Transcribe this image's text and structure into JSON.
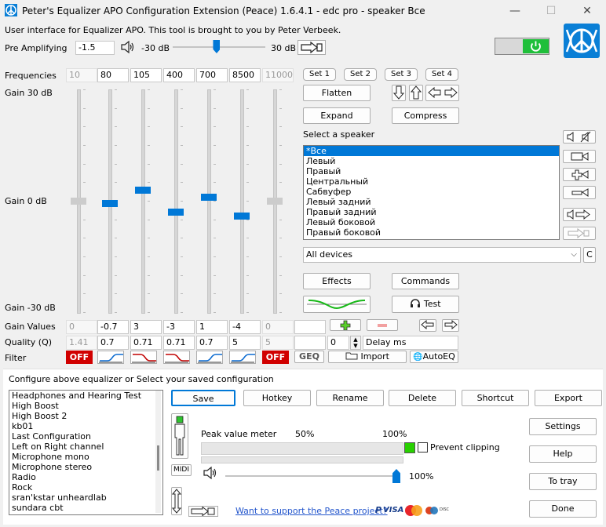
{
  "window": {
    "title": "Peter's Equalizer APO Configuration Extension (Peace) 1.6.4.1 - edc pro - speaker Все",
    "minimize": "—",
    "maximize": "☐",
    "close": "✕"
  },
  "intro": "User interface for Equalizer APO. This tool is brought to you by Peter Verbeek.",
  "preamp": {
    "label": "Pre Amplifying",
    "value": "-1.5",
    "min_label": "-30 dB",
    "max_label": "30 dB",
    "level_fraction": 0.47
  },
  "power_on": true,
  "eq": {
    "frequencies_label": "Frequencies",
    "gain_top_label": "Gain 30 dB",
    "gain_mid_label": "Gain 0 dB",
    "gain_bottom_label": "Gain -30 dB",
    "gain_values_label": "Gain Values",
    "quality_label": "Quality (Q)",
    "filter_label": "Filter",
    "bands": [
      {
        "freq": "10",
        "gain": "0",
        "q": "1.41",
        "filter": "OFF",
        "enabled": false,
        "gain_db": 0
      },
      {
        "freq": "80",
        "gain": "-0.7",
        "q": "0.7",
        "filter": "lowshelf",
        "enabled": true,
        "gain_db": -0.7
      },
      {
        "freq": "105",
        "gain": "3",
        "q": "0.71",
        "filter": "highshelf",
        "enabled": true,
        "gain_db": 3
      },
      {
        "freq": "400",
        "gain": "-3",
        "q": "0.71",
        "filter": "highshelf",
        "enabled": true,
        "gain_db": -3
      },
      {
        "freq": "700",
        "gain": "1",
        "q": "0.7",
        "filter": "lowshelf",
        "enabled": true,
        "gain_db": 1
      },
      {
        "freq": "8500",
        "gain": "-4",
        "q": "5",
        "filter": "lowshelf",
        "enabled": true,
        "gain_db": -4
      },
      {
        "freq": "11000",
        "gain": "0",
        "q": "5",
        "filter": "OFF",
        "enabled": false,
        "gain_db": 0
      }
    ],
    "delay_value": "0",
    "delay_label": "Delay ms",
    "geq": "GEQ",
    "import": "Import",
    "autoeq": "AutoEQ"
  },
  "sets": [
    "Set 1",
    "Set 2",
    "Set 3",
    "Set 4"
  ],
  "buttons": {
    "flatten": "Flatten",
    "expand": "Expand",
    "compress": "Compress",
    "effects": "Effects",
    "commands": "Commands",
    "test": "Test"
  },
  "speaker": {
    "label": "Select a speaker",
    "items": [
      "*Все",
      "Левый",
      "Правый",
      "Центральный",
      "Сабвуфер",
      "Левый задний",
      "Правый задний",
      "Левый боковой",
      "Правый боковой"
    ],
    "selected_index": 0,
    "device": "All devices",
    "device_extra": "C"
  },
  "config": {
    "label": "Configure above equalizer or Select your saved configuration",
    "items": [
      "Headphones and Hearing Test",
      "High Boost",
      "High Boost 2",
      "kb01",
      "Last Configuration",
      "Left on Right channel",
      "Microphone mono",
      "Microphone stereo",
      "Radio",
      "Rock",
      "sran'kstar unheardlab",
      "sundara cbt"
    ],
    "save": "Save",
    "hotkey": "Hotkey",
    "rename": "Rename",
    "delete": "Delete",
    "shortcut": "Shortcut",
    "export": "Export",
    "midi": "MIDI"
  },
  "meter": {
    "label": "Peak value meter",
    "p50": "50%",
    "p100": "100%",
    "prevent_clipping": "Prevent clipping",
    "volume": "100%",
    "volume_fraction": 1.0
  },
  "side": {
    "settings": "Settings",
    "help": "Help",
    "to_tray": "To tray",
    "done": "Done"
  },
  "support_link": "Want to support the Peace project?",
  "colors": {
    "accent": "#0078d7",
    "power": "#1fbf3a",
    "off": "#d10000",
    "meter_green": "#28d000",
    "logo": "#0a7fd6"
  }
}
